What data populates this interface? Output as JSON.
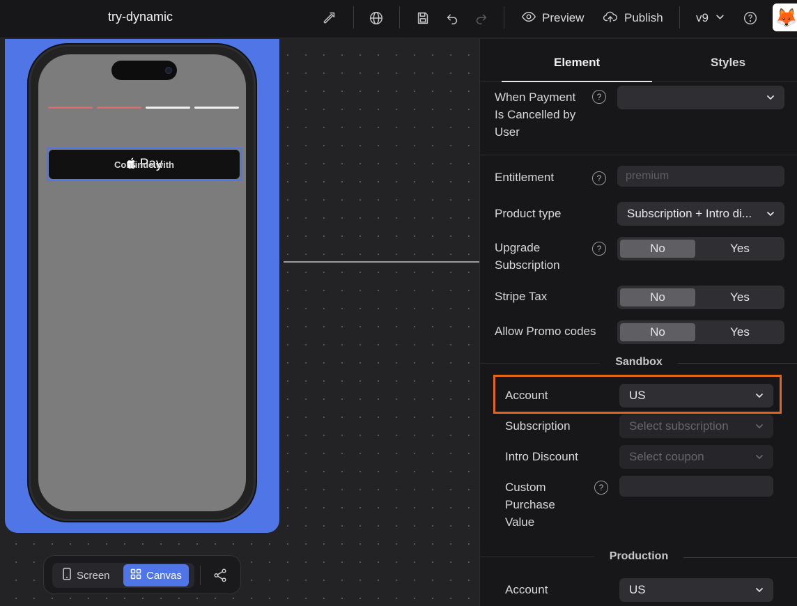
{
  "header": {
    "title": "try-dynamic",
    "preview_label": "Preview",
    "publish_label": "Publish",
    "version": "v9"
  },
  "canvas": {
    "pay_button": {
      "prefix": "Continue with",
      "pay": "Pay"
    },
    "progress_colors": [
      "#e06868",
      "#e06868",
      "#f2f2f2",
      "#f2f2f2"
    ],
    "toolbar": {
      "screen_label": "Screen",
      "canvas_label": "Canvas"
    }
  },
  "panel": {
    "tabs": {
      "element": "Element",
      "styles": "Styles"
    },
    "payment_cancelled": {
      "label_lines": [
        "When Payment",
        "Is Cancelled by",
        "User"
      ],
      "value": ""
    },
    "entitlement": {
      "label": "Entitlement",
      "placeholder": "premium"
    },
    "product_type": {
      "label": "Product type",
      "value": "Subscription + Intro di..."
    },
    "upgrade_subscription": {
      "label_lines": [
        "Upgrade",
        "Subscription"
      ],
      "no": "No",
      "yes": "Yes"
    },
    "stripe_tax": {
      "label": "Stripe Tax",
      "no": "No",
      "yes": "Yes"
    },
    "promo_codes": {
      "label": "Allow Promo codes",
      "no": "No",
      "yes": "Yes"
    },
    "sandbox": {
      "heading": "Sandbox",
      "account": {
        "label": "Account",
        "value": "US"
      },
      "subscription": {
        "label": "Subscription",
        "placeholder": "Select subscription"
      },
      "intro_discount": {
        "label": "Intro Discount",
        "placeholder": "Select coupon"
      },
      "custom_value": {
        "label_lines": [
          "Custom",
          "Purchase",
          "Value"
        ]
      }
    },
    "production": {
      "heading": "Production",
      "account": {
        "label": "Account",
        "value": "US"
      }
    },
    "accent_highlight": "#e2651a"
  }
}
